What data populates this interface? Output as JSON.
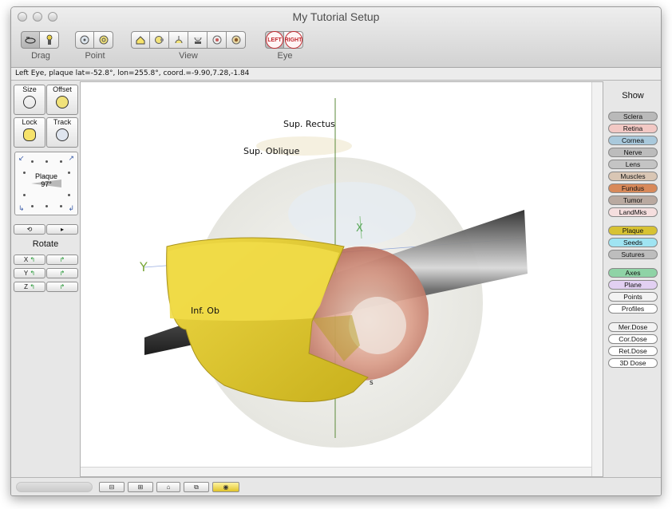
{
  "window": {
    "title": "My Tutorial Setup"
  },
  "toolbar": {
    "groups": [
      {
        "label": "Drag",
        "buttons": [
          "rotate-view-icon",
          "pan-hand-icon"
        ]
      },
      {
        "label": "Point",
        "buttons": [
          "point-eye-icon",
          "point-target-icon"
        ]
      },
      {
        "label": "View",
        "buttons": [
          "home-view-icon",
          "side-view-icon",
          "top-view-icon",
          "bottom-view-icon",
          "front-view-icon",
          "back-view-icon"
        ]
      }
    ],
    "eye": {
      "label": "Eye",
      "left": "LEFT",
      "right": "RIGHT"
    }
  },
  "status": "Left Eye, plaque lat=-52.8°, lon=255.8°, coord.=-9.90,7.28,-1.84",
  "left_panel": {
    "size": "Size",
    "offset": "Offset",
    "lock": "Lock",
    "track": "Track",
    "dial": {
      "name": "Plaque",
      "angle": "97°"
    },
    "rotate": "Rotate",
    "axes": [
      "X",
      "Y",
      "Z"
    ]
  },
  "viewport": {
    "labels": {
      "sup_rectus": "Sup. Rectus",
      "sup_oblique": "Sup. Oblique",
      "inf_ob": "Inf. Ob",
      "y_axis": "Y",
      "x_axis": "X",
      "trunc": "s"
    }
  },
  "right_panel": {
    "title": "Show",
    "toggles": [
      {
        "label": "Sclera",
        "color": "#b9b9b9"
      },
      {
        "label": "Retina",
        "color": "#f2c8c4"
      },
      {
        "label": "Cornea",
        "color": "#a9c9dc"
      },
      {
        "label": "Nerve",
        "color": "#bcbcbc"
      },
      {
        "label": "Lens",
        "color": "#c4c4c4"
      },
      {
        "label": "Muscles",
        "color": "#d9c6b4"
      },
      {
        "label": "Fundus",
        "color": "#d8895a"
      },
      {
        "label": "Tumor",
        "color": "#b9a9a0"
      },
      {
        "label": "LandMks",
        "color": "#f5dede"
      },
      {
        "label": "Plaque",
        "color": "#d7c233"
      },
      {
        "label": "Seeds",
        "color": "#9fe4f2"
      },
      {
        "label": "Sutures",
        "color": "#bdbdbd"
      },
      {
        "label": "Axes",
        "color": "#8fd3a6"
      },
      {
        "label": "Plane",
        "color": "#e2d0f2"
      },
      {
        "label": "Points",
        "color": "#f3f3f3"
      },
      {
        "label": "Profiles",
        "color": "#ffffff"
      },
      {
        "label": "Mer.Dose",
        "color": "#f3f3f3"
      },
      {
        "label": "Cor.Dose",
        "color": "#ffffff"
      },
      {
        "label": "Ret.Dose",
        "color": "#ffffff"
      },
      {
        "label": "3D Dose",
        "color": "#ffffff"
      }
    ]
  }
}
